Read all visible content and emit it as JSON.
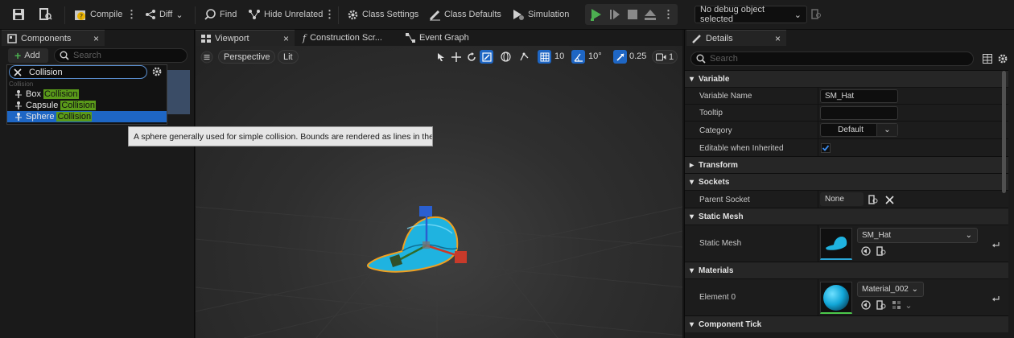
{
  "toolbar": {
    "compile": "Compile",
    "diff": "Diff",
    "find": "Find",
    "hide_unrelated": "Hide Unrelated",
    "class_settings": "Class Settings",
    "class_defaults": "Class Defaults",
    "simulation": "Simulation",
    "debug_object": "No debug object selected"
  },
  "components_panel": {
    "tab": "Components",
    "close": "×",
    "add": "Add",
    "search_placeholder": "Search",
    "filter_value": "Collision",
    "category": "Collision",
    "items": [
      {
        "prefix": "Box ",
        "match": "Collision"
      },
      {
        "prefix": "Capsule ",
        "match": "Collision"
      },
      {
        "prefix": "Sphere ",
        "match": "Collision",
        "selected": true
      }
    ],
    "tooltip": "A sphere generally used for simple collision. Bounds are rendered as lines in the editor."
  },
  "center_tabs": {
    "viewport": "Viewport",
    "close": "×",
    "construction": "Construction Scr...",
    "event_graph": "Event Graph"
  },
  "viewport": {
    "perspective": "Perspective",
    "lit": "Lit",
    "grid_snap": "10",
    "rot_snap": "10°",
    "scale_snap": "0.25",
    "camera_speed": "1"
  },
  "details": {
    "tab": "Details",
    "close": "×",
    "search_placeholder": "Search",
    "sections": {
      "variable": "Variable",
      "transform": "Transform",
      "sockets": "Sockets",
      "static_mesh": "Static Mesh",
      "materials": "Materials",
      "component_tick": "Component Tick"
    },
    "labels": {
      "variable_name": "Variable Name",
      "tooltip": "Tooltip",
      "category": "Category",
      "editable_inherited": "Editable when Inherited",
      "parent_socket": "Parent Socket",
      "static_mesh": "Static Mesh",
      "element0": "Element 0"
    },
    "values": {
      "variable_name": "SM_Hat",
      "tooltip": "",
      "category": "Default",
      "editable_inherited": true,
      "parent_socket": "None",
      "static_mesh": "SM_Hat",
      "material": "Material_002"
    }
  },
  "colors": {
    "accent_blue": "#1e66c4",
    "match_green": "#5a9a1a",
    "play_green": "#4caf50",
    "hat_cyan": "#1fb3e0"
  }
}
